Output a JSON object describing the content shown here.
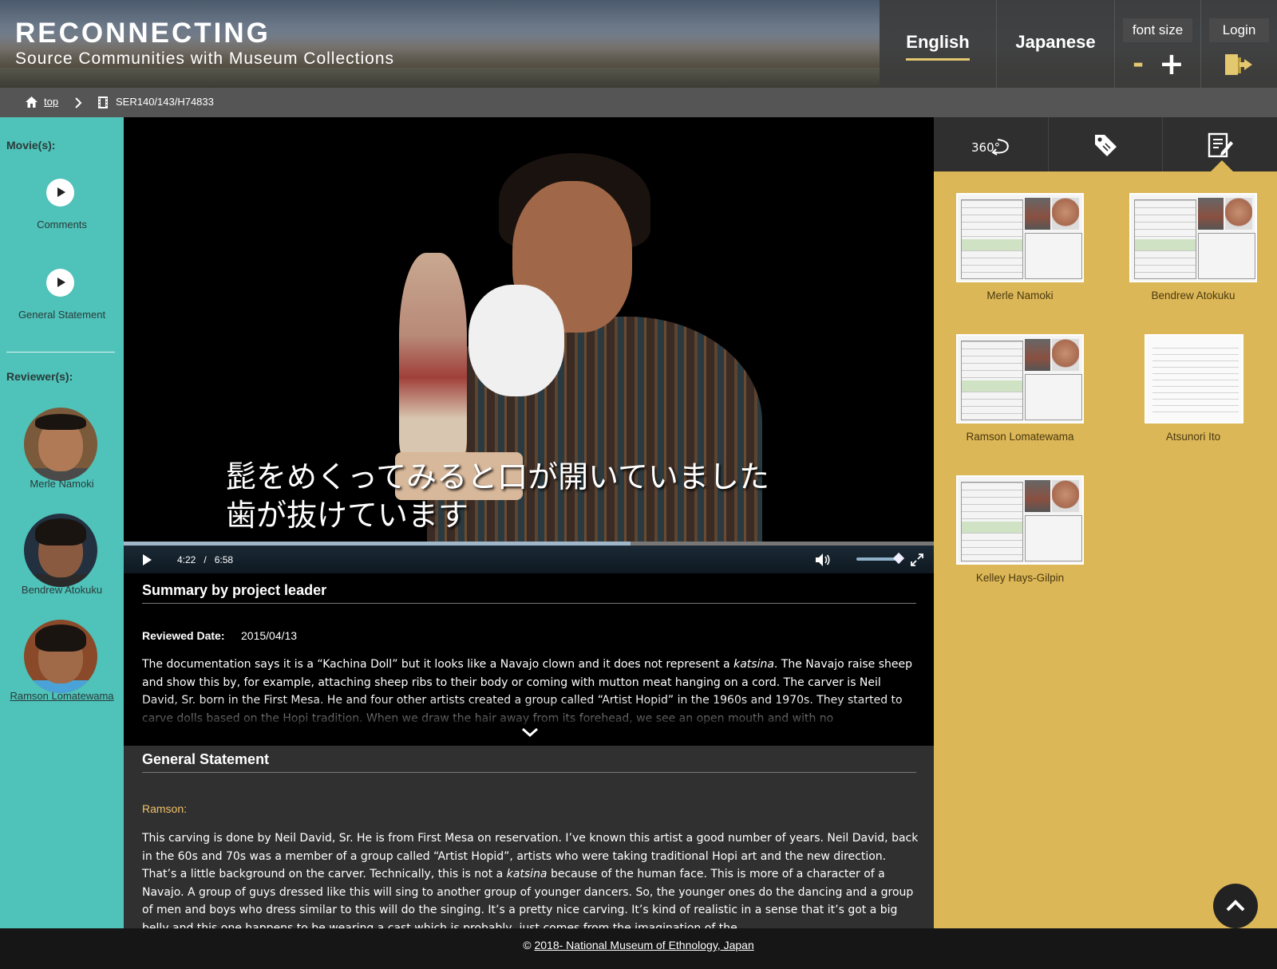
{
  "header": {
    "title": "RECONNECTING",
    "subtitle": "Source Communities with Museum Collections",
    "lang_english": "English",
    "lang_japanese": "Japanese",
    "font_size_label": "font size",
    "font_minus": "-",
    "font_plus": "+",
    "login_label": "Login"
  },
  "breadcrumb": {
    "top": "top",
    "separator": ">",
    "current": "SER140/143/H74833"
  },
  "sidebar": {
    "movies_heading": "Movie(s):",
    "movies": [
      {
        "label": "Comments"
      },
      {
        "label": "General Statement"
      }
    ],
    "reviewers_heading": "Reviewer(s):",
    "reviewers": [
      {
        "name": "Merle Namoki"
      },
      {
        "name": "Bendrew Atokuku"
      },
      {
        "name": "Ramson Lomatewama"
      }
    ]
  },
  "video": {
    "subtitle_line1": "髭をめくってみると口が開いていました",
    "subtitle_line2": "歯が抜けています",
    "current_time": "4:22",
    "time_separator": "/",
    "duration": "6:58",
    "progress_fraction": 0.626,
    "volume_fraction": 0.9
  },
  "summary": {
    "title": "Summary by project leader",
    "reviewed_date_label": "Reviewed Date:",
    "reviewed_date": "2015/04/13",
    "text_p1_a": "The documentation says it is a “Kachina Doll” but it looks like a Navajo clown and it does not represent a ",
    "text_p1_em": "katsina",
    "text_p1_b": ". The Navajo raise sheep and show this by, for example, attaching sheep ribs to their body or coming with mutton meat hanging on a cord. The carver is Neil David, Sr. born in the First Mesa. He and four other artists created a group called “Artist Hopid” in the 1960s and 1970s. They started to carve dolls based on the Hopi tradition. When we draw the hair away from its forehead, we see an open mouth and with no"
  },
  "general_statement": {
    "title": "General Statement",
    "speaker": "Ramson:",
    "text_a": "This carving is done by Neil David, Sr. He is from First Mesa on reservation. I’ve known this artist a good number of years. Neil David, back in the 60s and 70s was a member of a group called “Artist Hopid”, artists who were taking traditional Hopi art and the new direction. That’s a little background on the carver. Technically, this is not a ",
    "text_em": "katsina",
    "text_b": " because of the human face. This is more of a character of a Navajo. A group of guys dressed like this will sing to another group of younger dancers. So, the younger ones do the dancing and a group of men and boys who dress similar to this will do the singing. It’s a pretty nice carving. It’s kind of realistic in a sense that it’s got a big belly and this one happens to be wearing a cast which is probably, just comes from the imagination of the"
  },
  "right_panel": {
    "tabs": [
      {
        "icon": "rotate-360-icon",
        "label": "360°"
      },
      {
        "icon": "tag-icon"
      },
      {
        "icon": "notes-icon"
      }
    ],
    "documents": [
      {
        "name": "Merle Namoki",
        "kind": "form"
      },
      {
        "name": "Bendrew Atokuku",
        "kind": "form"
      },
      {
        "name": "Ramson Lomatewama",
        "kind": "form"
      },
      {
        "name": "Atsunori Ito",
        "kind": "handwritten"
      },
      {
        "name": "Kelley Hays-Gilpin",
        "kind": "form"
      }
    ]
  },
  "footer": {
    "copyright_symbol": "©",
    "link_text": "2018- National Museum of Ethnology, Japan"
  },
  "colors": {
    "sidebar_bg": "#4fc2b9",
    "right_panel_bg": "#dcb757",
    "accent_underline": "#e3c870",
    "speaker_color": "#f0c36a"
  }
}
